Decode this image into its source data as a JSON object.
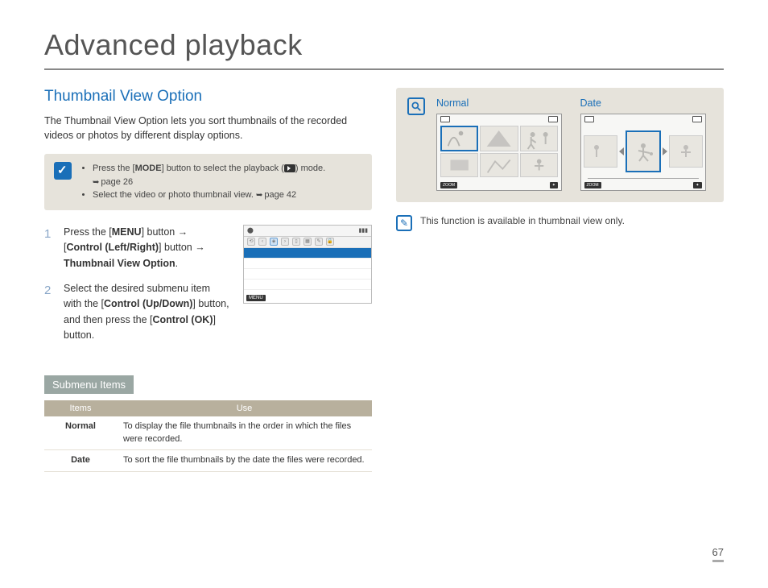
{
  "title": "Advanced playback",
  "section": "Thumbnail View Option",
  "intro": "The Thumbnail View Option lets you sort thumbnails of the recorded videos or photos by different display options.",
  "notes": {
    "item1_pre": "Press the [",
    "item1_bold": "MODE",
    "item1_post": "] button to select the playback (",
    "item1_end": ") mode.",
    "item1_ref": "page 26",
    "item2": "Select the video or photo thumbnail view. ",
    "item2_ref": "page 42"
  },
  "steps": [
    {
      "num": "1",
      "l1a": "Press the [",
      "l1b": "MENU",
      "l1c": "] button →",
      "l2a": "[",
      "l2b": "Control (Left/Right)",
      "l2c": "] button →",
      "l3": "Thumbnail View Option",
      "l3end": "."
    },
    {
      "num": "2",
      "t1": "Select the desired submenu item with the [",
      "t1b": "Control (Up/Down)",
      "t2": "] button, and then press the [",
      "t2b": "Control (OK)",
      "t3": "] button."
    }
  ],
  "menu_footer": "MENU",
  "submenu_heading": "Submenu Items",
  "table": {
    "h1": "Items",
    "h2": "Use",
    "rows": [
      {
        "item": "Normal",
        "use": "To display the file thumbnails in the order in which the files were recorded."
      },
      {
        "item": "Date",
        "use": "To sort the file thumbnails by the date the files were recorded."
      }
    ]
  },
  "examples": {
    "normal": "Normal",
    "date": "Date",
    "zoom": "ZOOM"
  },
  "footnote": "This function is available in thumbnail view only.",
  "page": "67"
}
